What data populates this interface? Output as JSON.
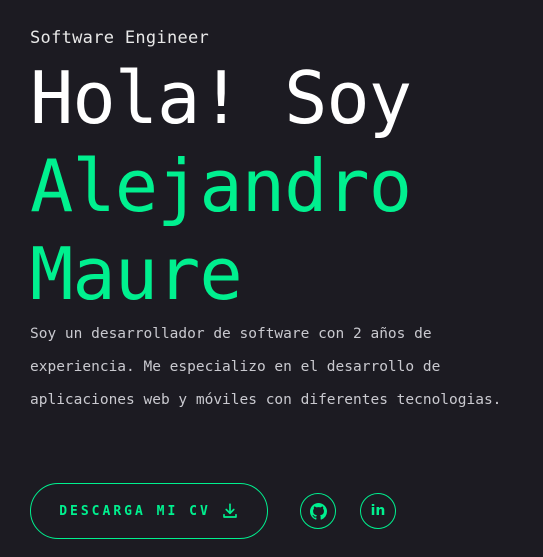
{
  "hero": {
    "role": "Software Engineer",
    "greeting": "Hola! Soy",
    "name_line1": "Alejandro",
    "name_line2": "Maure",
    "bio": "Soy un desarrollador de software con 2 años de experiencia. Me especializo en el desarrollo de aplicaciones web y móviles con diferentes tecnologias."
  },
  "actions": {
    "cv_label": "DESCARGA MI CV",
    "cv_icon": "download-icon",
    "github_icon": "github-icon",
    "linkedin_text": "in"
  },
  "colors": {
    "background": "#1c1b22",
    "accent": "#00f08f",
    "heading": "#ffffff",
    "body_text": "#c9c9cf"
  }
}
